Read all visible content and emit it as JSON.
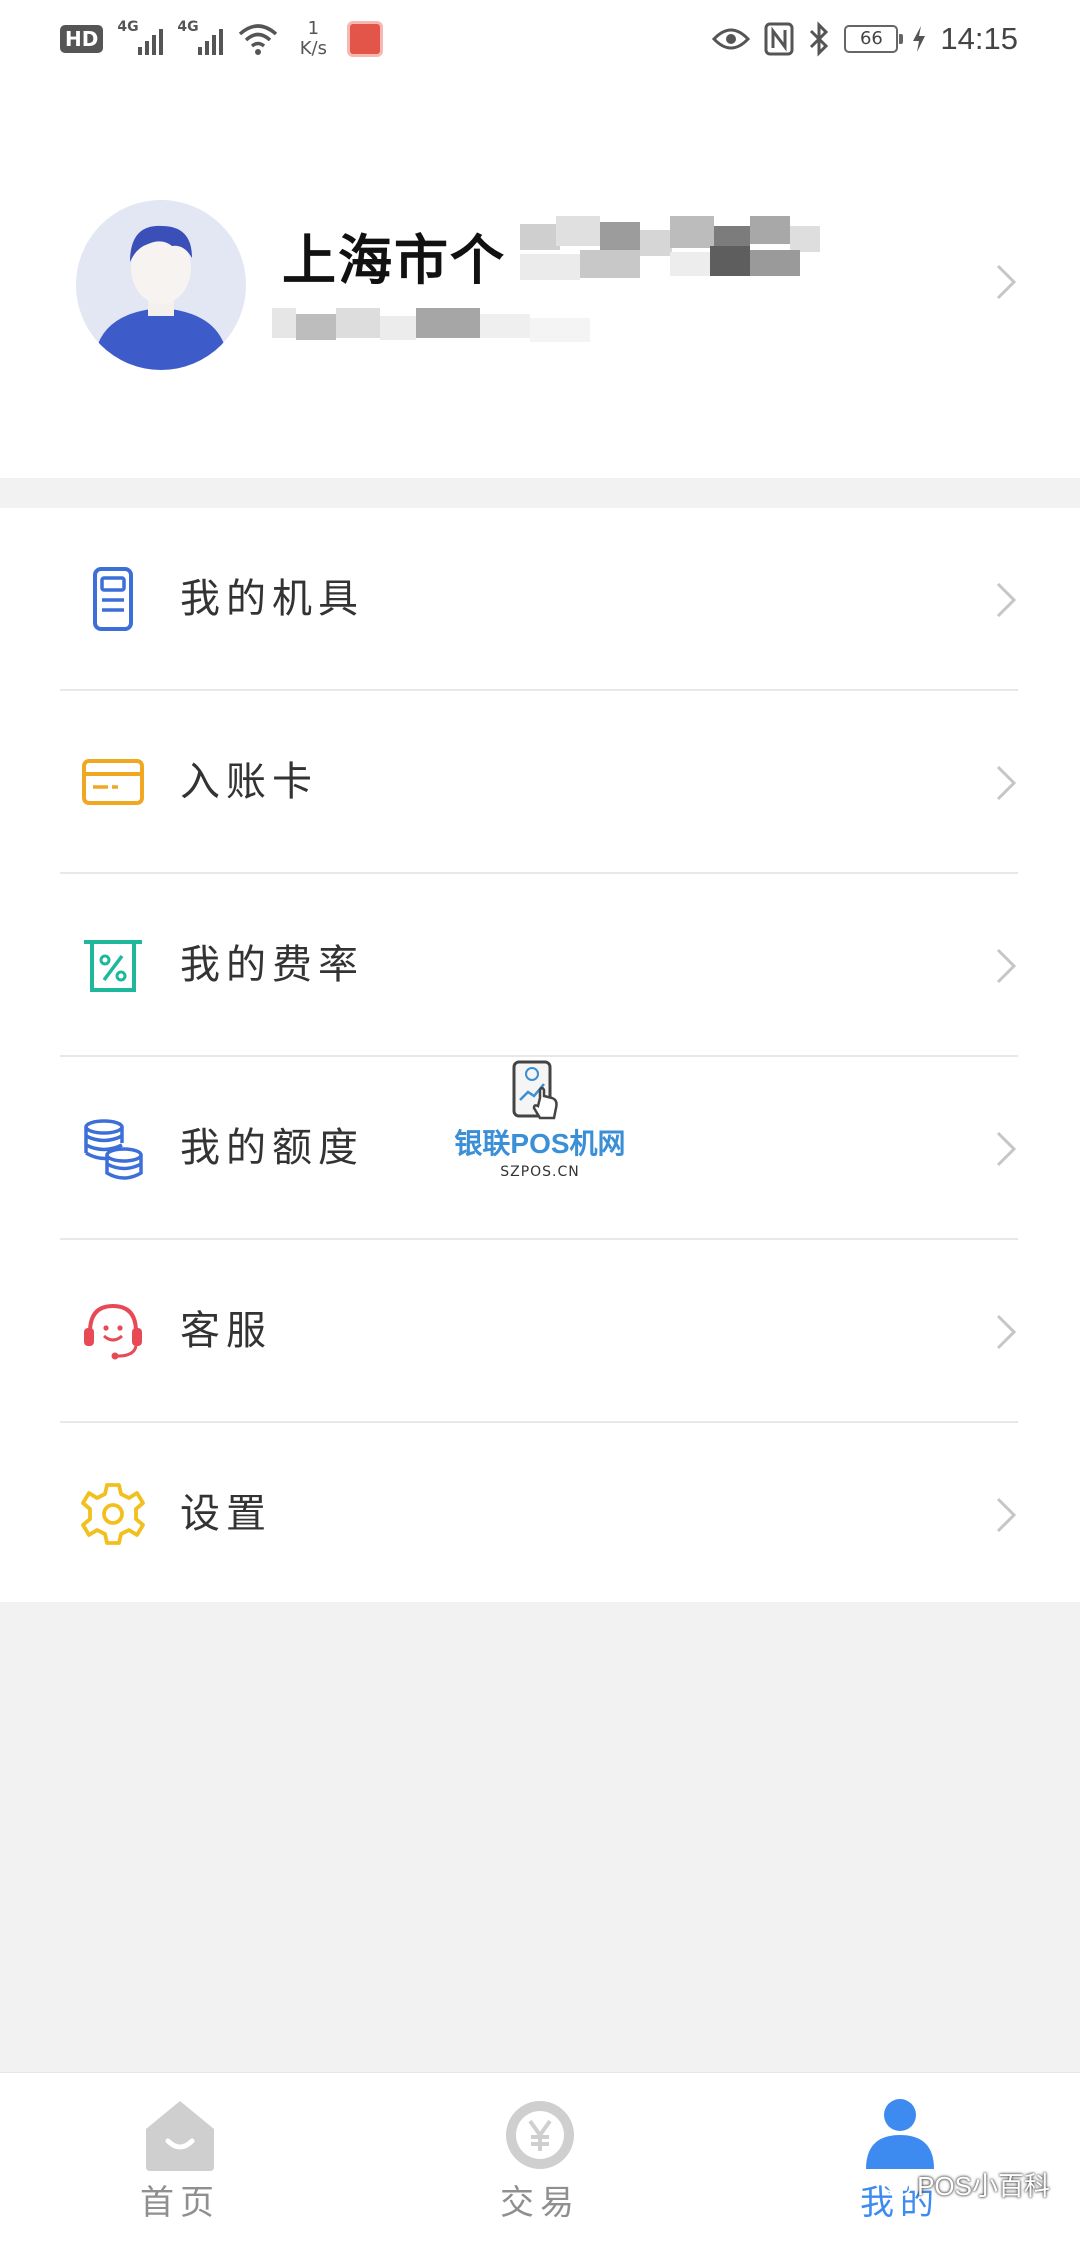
{
  "status_bar": {
    "hd": "HD",
    "network_1": "4G",
    "network_2": "4G",
    "speed_value": "1",
    "speed_unit": "K/s",
    "battery": "66",
    "time": "14:15"
  },
  "profile": {
    "name_visible": "上海市个",
    "avatar_bg": "#e3e6f3",
    "avatar_shirt": "#3d5cc9",
    "avatar_hair": "#3b4fb8"
  },
  "menu": {
    "items": [
      {
        "label": "我的机具",
        "icon": "pos-terminal-icon",
        "color": "#3d6fd9"
      },
      {
        "label": "入账卡",
        "icon": "bank-card-icon",
        "color": "#f0a823"
      },
      {
        "label": "我的费率",
        "icon": "rate-percent-icon",
        "color": "#1fb89a"
      },
      {
        "label": "我的额度",
        "icon": "coin-stack-icon",
        "color": "#3d6fd9"
      },
      {
        "label": "客服",
        "icon": "headset-icon",
        "color": "#e84a55"
      },
      {
        "label": "设置",
        "icon": "gear-icon",
        "color": "#f2c01e"
      }
    ]
  },
  "watermark": {
    "title": "银联POS机网",
    "subtitle": "SZPOS.CN"
  },
  "bottom_nav": {
    "items": [
      {
        "label": "首页",
        "icon": "home-icon",
        "active": false
      },
      {
        "label": "交易",
        "icon": "yen-coin-icon",
        "active": false
      },
      {
        "label": "我的",
        "icon": "person-icon",
        "active": true
      }
    ],
    "active_color": "#3d8bf0",
    "inactive_color": "#c8c8c8"
  },
  "footer_watermark": "POS小百科"
}
